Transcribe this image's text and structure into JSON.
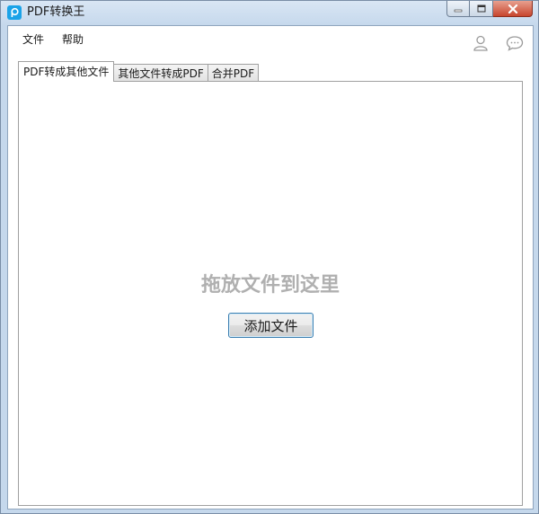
{
  "window": {
    "title": "PDF转换王",
    "icon": "app-logo-p-icon",
    "accent_color": "#1aa3e8"
  },
  "menu": {
    "items": [
      {
        "label": "文件"
      },
      {
        "label": "帮助"
      }
    ]
  },
  "toolbar_icons": [
    "user-icon",
    "chat-bubble-icon"
  ],
  "tabs": [
    {
      "label": "PDF转成其他文件",
      "active": true
    },
    {
      "label": "其他文件转成PDF",
      "active": false
    },
    {
      "label": "合并PDF",
      "active": false
    }
  ],
  "panel": {
    "drop_hint": "拖放文件到这里",
    "add_button_label": "添加文件"
  }
}
